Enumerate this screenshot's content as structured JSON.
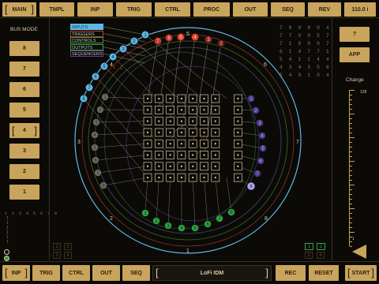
{
  "top_tabs": [
    "MAIN",
    "TMPL",
    "INP",
    "TRIG",
    "CTRL",
    "PROC",
    "OUT",
    "SEQ",
    "REV",
    "110.0 i"
  ],
  "bottom_tabs": [
    "INP",
    "TRIG",
    "CTRL",
    "OUT",
    "SEQ"
  ],
  "bottom_title": "LoFi IDM",
  "bottom_right": [
    "REC",
    "RESET",
    "START"
  ],
  "bus_mode": {
    "title": "BUS MODE",
    "buttons": [
      "8",
      "7",
      "6",
      "5",
      "4",
      "3",
      "2",
      "1"
    ],
    "selected": "4"
  },
  "left_bottom_grid": [
    "1 2 3 4 5 6 7 8",
    "1",
    "1",
    "1",
    "1",
    "1",
    "1"
  ],
  "right_panel": {
    "question": "?",
    "app": "APP",
    "change_label": "Change",
    "slider_top": "128",
    "slider_bottom": "1"
  },
  "legend": [
    "INPUTS",
    "TRIGGERS",
    "CONTROLS",
    "OUTPUTS",
    "SEQUENCERS"
  ],
  "legend_colors": [
    "#5cb8e6",
    "#c0392b",
    "#2ea043",
    "#3aa040",
    "#5a3fa0"
  ],
  "ring_labels": {
    "top": "5",
    "top_right": "6",
    "right": "7",
    "bottom_right": "8",
    "bottom": "1",
    "bottom_left": "2",
    "left": "3",
    "top_left": "4"
  },
  "input_nodes": [
    "1",
    "2",
    "3",
    "4",
    "5",
    "6",
    "7",
    "8"
  ],
  "trigger_nodes": [
    "1",
    "2",
    "3",
    "4",
    "5",
    "6",
    "7",
    "8"
  ],
  "control_nodes": [
    "1",
    "2",
    "3",
    "4",
    "5",
    "6",
    "7",
    "8"
  ],
  "output_nodes": [
    "1",
    "2",
    "3",
    "4",
    "5",
    "6",
    "7",
    "8"
  ],
  "sequencer_nodes": [
    "1",
    "2",
    "3",
    "4",
    "5",
    "6",
    "7",
    "8"
  ],
  "gray_nodes": [
    "1",
    "2",
    "3",
    "4",
    "5",
    "6",
    "7",
    "8",
    "9"
  ],
  "numgrid_rows": [
    "7 8 0 8 0 4",
    "7 7 0 0 5 7",
    "7 1 8 0 0 7",
    "6 1 4 7 7 1",
    "5 4 1 1 4 4",
    "4 3 4 3 5 6",
    "5 4 0 1 0 4"
  ],
  "small_boxes_left": [
    "1",
    "2",
    "3",
    "4"
  ],
  "small_boxes_right": [
    "1",
    "2",
    "3",
    "4"
  ]
}
